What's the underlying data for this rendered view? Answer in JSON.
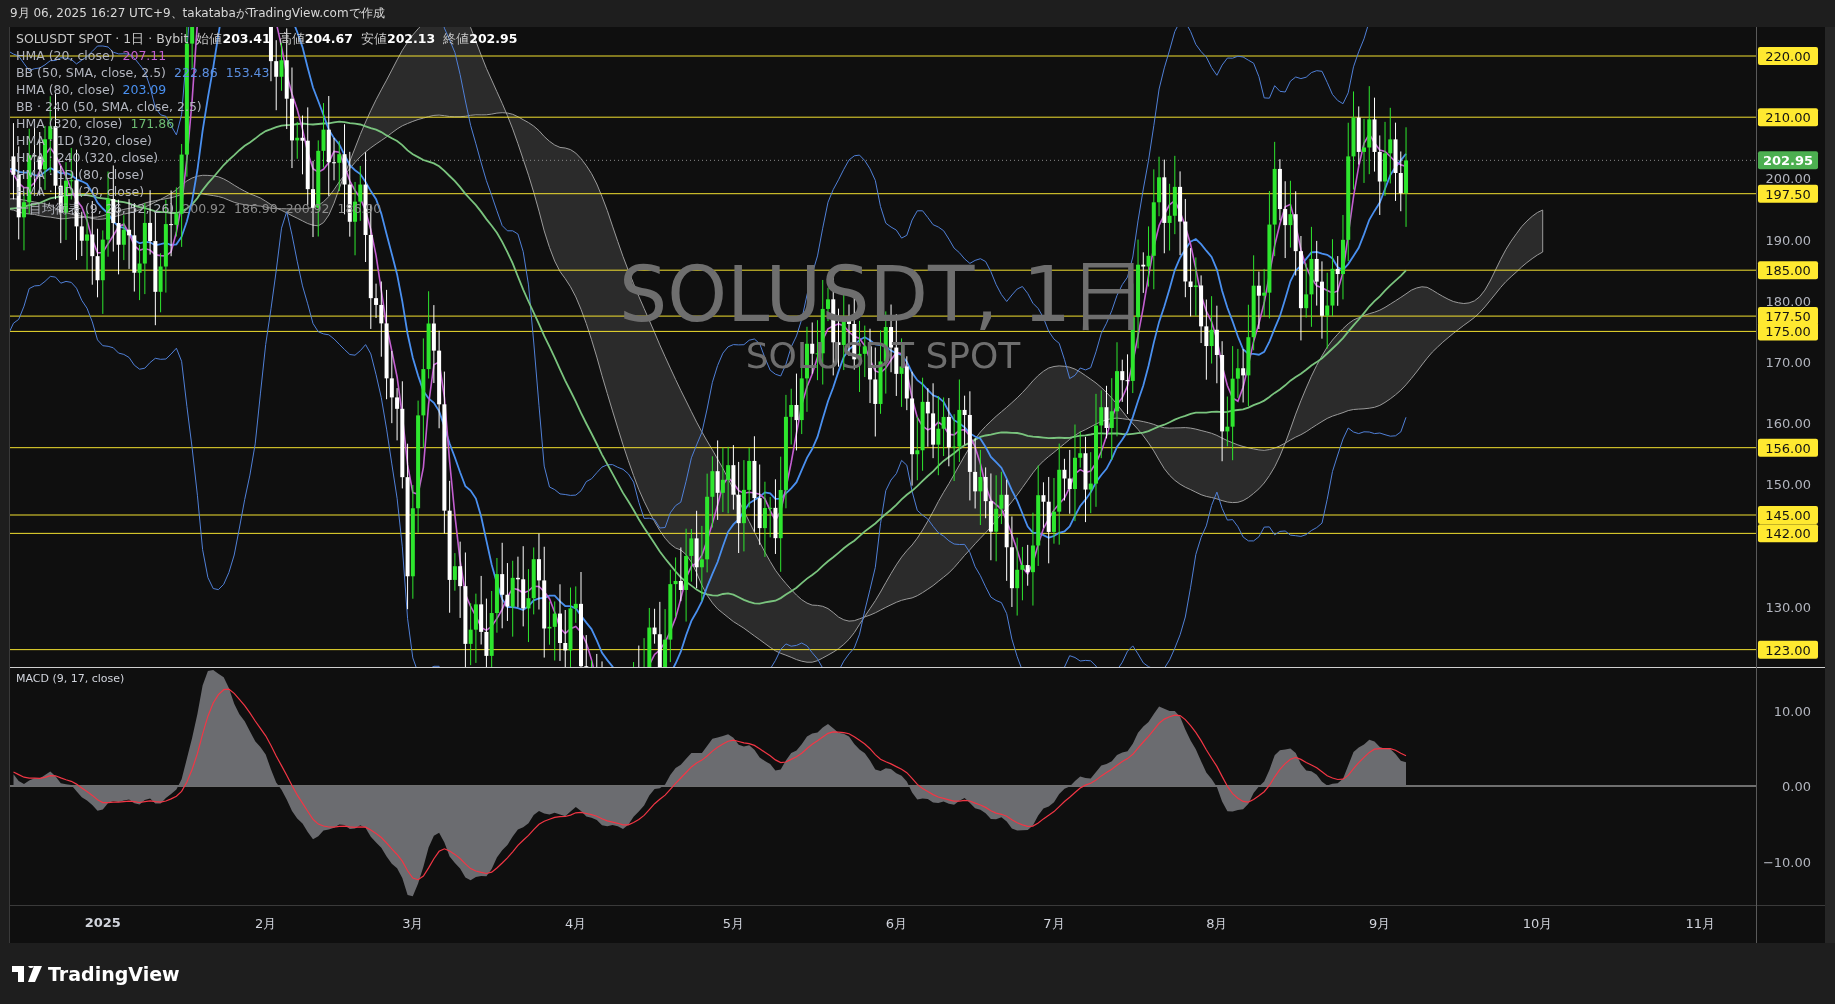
{
  "header": {
    "caption": "9月 06, 2025 16:27 UTC+9、takatabaがTradingView.comで作成"
  },
  "legend": {
    "symbol": "SOLUSDT SPOT · 1日 · Bybit",
    "ohlc": [
      {
        "label": "始値",
        "value": "203.41"
      },
      {
        "label": "高値",
        "value": "204.67"
      },
      {
        "label": "安値",
        "value": "202.13"
      },
      {
        "label": "終値",
        "value": "202.95"
      }
    ],
    "indicators": [
      {
        "name": "HMA (20, close)",
        "values": [
          "207.11"
        ],
        "color": "#c35fd0"
      },
      {
        "name": "BB (50, SMA, close, 2.5)",
        "values": [
          "222.86",
          "153.43"
        ],
        "color": "#5b8fe0"
      },
      {
        "name": "HMA (80, close)",
        "values": [
          "203.09"
        ],
        "color": "#4a90f0"
      },
      {
        "name": "BB · 240 (50, SMA, close, 2.5)"
      },
      {
        "name": "HMA (320, close)",
        "values": [
          "171.86"
        ],
        "color": "#6dbb72"
      },
      {
        "name": "HMA · 1D (320, close)"
      },
      {
        "name": "HMA · 240 (320, close)"
      },
      {
        "name": "HMA · 1D (80, close)"
      },
      {
        "name": "HMA · 1D (20, close)"
      },
      {
        "name": "一目均衡表 (9, 26, 52, 26)",
        "values": [
          "200.92",
          "186.90",
          "200.92",
          "186.90"
        ],
        "color": "#8c8c8c"
      }
    ]
  },
  "watermark": {
    "symbol": "SOLUSDT, 1日",
    "subtitle": "SOLUSDT SPOT"
  },
  "price_axis": {
    "ticks": [
      "200.00",
      "190.00",
      "180.00",
      "170.00",
      "160.00",
      "150.00",
      "130.00"
    ],
    "levels": [
      "220.00",
      "210.00",
      "197.50",
      "185.00",
      "177.50",
      "175.00",
      "156.00",
      "145.00",
      "142.00",
      "123.00"
    ],
    "current_price": "202.95"
  },
  "macd": {
    "title": "MACD (9, 17, close)",
    "ticks": [
      "10.00",
      "0.00",
      "−10.00"
    ]
  },
  "time_axis": {
    "labels": [
      "2025",
      "2月",
      "3月",
      "4月",
      "5月",
      "6月",
      "7月",
      "8月",
      "9月",
      "10月",
      "11月"
    ]
  },
  "footer": {
    "logo": "TradingView"
  }
}
